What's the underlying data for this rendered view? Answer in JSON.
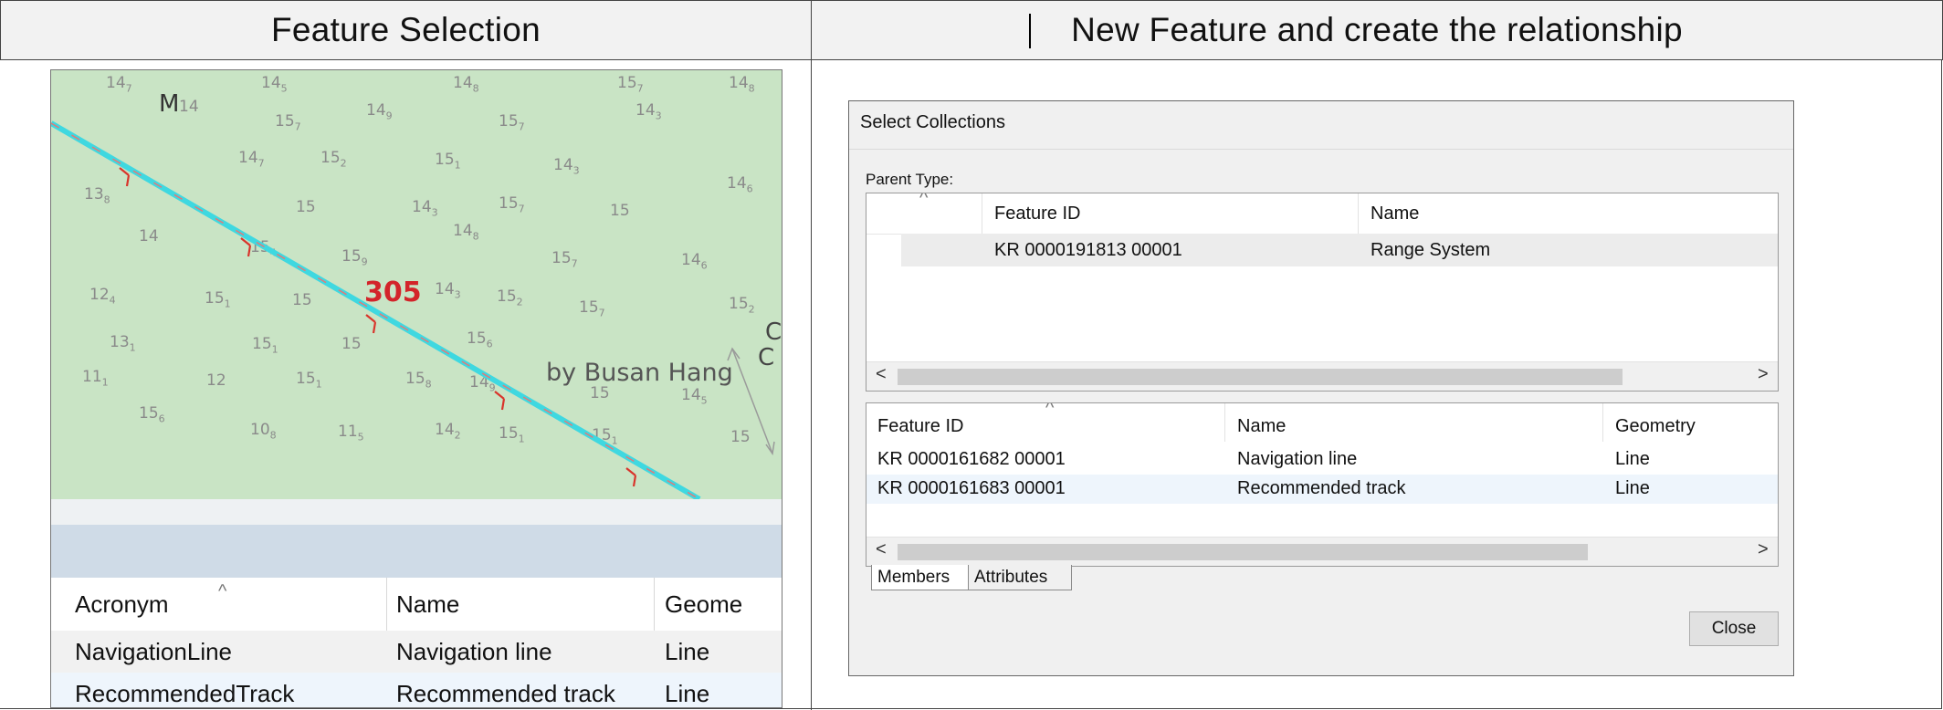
{
  "headers": {
    "left": "Feature Selection",
    "right": "New Feature and create the relationship"
  },
  "map": {
    "marker_letter": "M",
    "route_label": "305",
    "place_label": "by Busan Hang",
    "edge_label_1": "C",
    "edge_label_2": "C",
    "soundings": [
      {
        "main": "14",
        "sub": "7"
      },
      {
        "main": "14",
        "sub": "5"
      },
      {
        "main": "14",
        "sub": "8"
      },
      {
        "main": "15",
        "sub": "7"
      },
      {
        "main": "14",
        "sub": "8"
      },
      {
        "main": "14",
        "sub": ""
      },
      {
        "main": "15",
        "sub": "7"
      },
      {
        "main": "14",
        "sub": "9"
      },
      {
        "main": "15",
        "sub": "7"
      },
      {
        "main": "14",
        "sub": "3"
      },
      {
        "main": "14",
        "sub": "7"
      },
      {
        "main": "15",
        "sub": "2"
      },
      {
        "main": "15",
        "sub": "1"
      },
      {
        "main": "14",
        "sub": "3"
      },
      {
        "main": "14",
        "sub": "6"
      },
      {
        "main": "13",
        "sub": "8"
      },
      {
        "main": "15",
        "sub": ""
      },
      {
        "main": "14",
        "sub": "3"
      },
      {
        "main": "15",
        "sub": "7"
      },
      {
        "main": "15",
        "sub": ""
      },
      {
        "main": "14",
        "sub": ""
      },
      {
        "main": "15",
        "sub": "4"
      },
      {
        "main": "15",
        "sub": "9"
      },
      {
        "main": "14",
        "sub": "8"
      },
      {
        "main": "15",
        "sub": "7"
      },
      {
        "main": "14",
        "sub": "6"
      },
      {
        "main": "12",
        "sub": "4"
      },
      {
        "main": "15",
        "sub": "1"
      },
      {
        "main": "15",
        "sub": ""
      },
      {
        "main": "14",
        "sub": "3"
      },
      {
        "main": "15",
        "sub": "2"
      },
      {
        "main": "15",
        "sub": "7"
      },
      {
        "main": "15",
        "sub": "2"
      },
      {
        "main": "13",
        "sub": "1"
      },
      {
        "main": "15",
        "sub": "1"
      },
      {
        "main": "15",
        "sub": ""
      },
      {
        "main": "15",
        "sub": "6"
      },
      {
        "main": "11",
        "sub": "1"
      },
      {
        "main": "12",
        "sub": ""
      },
      {
        "main": "15",
        "sub": "1"
      },
      {
        "main": "15",
        "sub": "8"
      },
      {
        "main": "14",
        "sub": "9"
      },
      {
        "main": "15",
        "sub": ""
      },
      {
        "main": "14",
        "sub": "5"
      },
      {
        "main": "15",
        "sub": "6"
      },
      {
        "main": "10",
        "sub": "8"
      },
      {
        "main": "11",
        "sub": "5"
      },
      {
        "main": "14",
        "sub": "2"
      },
      {
        "main": "15",
        "sub": "1"
      },
      {
        "main": "15",
        "sub": "1"
      },
      {
        "main": "15",
        "sub": ""
      },
      {
        "main": "15",
        "sub": "3"
      }
    ]
  },
  "feature_table": {
    "columns": [
      "Acronym",
      "Name",
      "Geome"
    ],
    "rows": [
      {
        "acronym": "NavigationLine",
        "name": "Navigation line",
        "geometry": "Line"
      },
      {
        "acronym": "RecommendedTrack",
        "name": "Recommended track",
        "geometry": "Line"
      }
    ]
  },
  "dialog": {
    "title": "Select Collections",
    "parent_type_label": "Parent Type:",
    "parent_columns": [
      "Feature ID",
      "Name"
    ],
    "parent_rows": [
      {
        "feature_id": "KR 0000191813 00001",
        "name": "Range System"
      }
    ],
    "member_columns": [
      "Feature ID",
      "Name",
      "Geometry"
    ],
    "member_rows": [
      {
        "feature_id": "KR 0000161682 00001",
        "name": "Navigation line",
        "geometry": "Line"
      },
      {
        "feature_id": "KR 0000161683 00001",
        "name": "Recommended track",
        "geometry": "Line"
      }
    ],
    "tabs": [
      "Members",
      "Attributes"
    ],
    "close_label": "Close",
    "scroll_left": "<",
    "scroll_right": ">",
    "sort_glyph": "^"
  },
  "colors": {
    "map_land": "#c9e4c5",
    "route_line": "#3fd8e0",
    "route_marks": "#d9342b",
    "header_bg": "#f2f2f2"
  }
}
